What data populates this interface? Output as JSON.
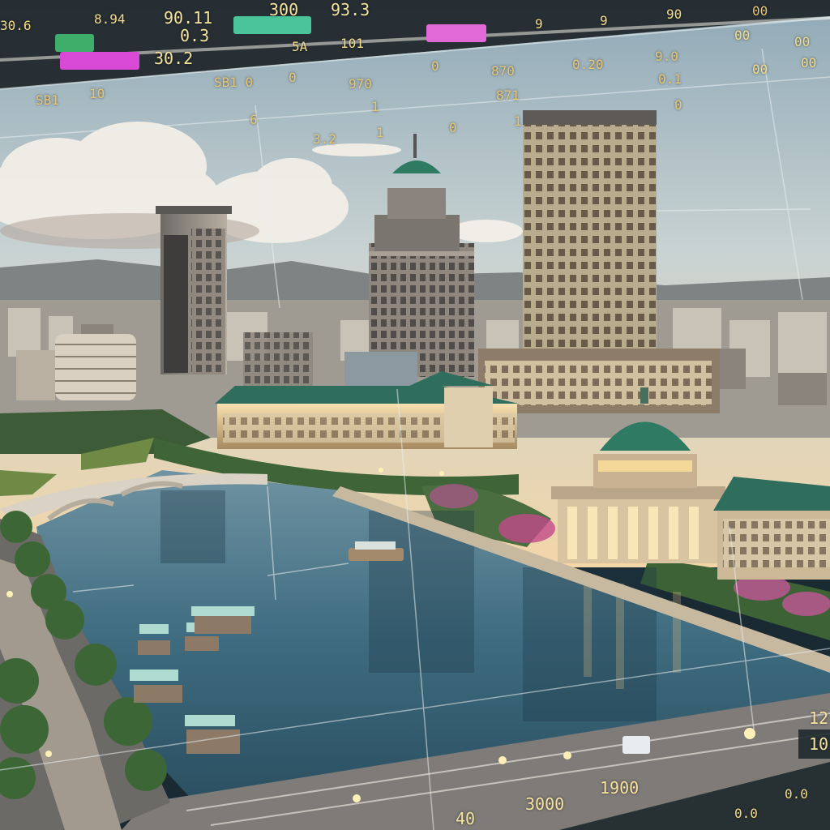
{
  "colors": {
    "sky_top": "#9fb6c2",
    "sky_horizon": "#f4d8ad",
    "water": "#3d6b80",
    "roof_green": "#2f7a63",
    "hud_text": "#f3dc8c",
    "chip_green": "#3fae6a",
    "chip_teal": "#49c49b",
    "chip_magenta": "#d84ad6",
    "chip_pink": "#e26ad8"
  },
  "hud_top": {
    "labels": [
      "30.6",
      "8.94",
      "90.11",
      "0.3",
      "300",
      "93.3",
      "30.2",
      "5A",
      "101",
      "9",
      "9",
      "90",
      "00",
      "00",
      "00",
      "00"
    ]
  },
  "hud_mid": {
    "labels": [
      "SB1",
      "10",
      "SB1 0",
      "0",
      "970",
      "0",
      "870",
      "0.20",
      "9.0",
      "0.1",
      "00",
      "871",
      "0",
      "6",
      "1",
      "3.2",
      "1",
      "0",
      "1"
    ]
  },
  "hud_bottom": {
    "labels": [
      "1900",
      "3000",
      "40",
      "12",
      "10",
      "0.0",
      "0.0"
    ]
  },
  "icons": [
    "hud-overlay-icon"
  ]
}
